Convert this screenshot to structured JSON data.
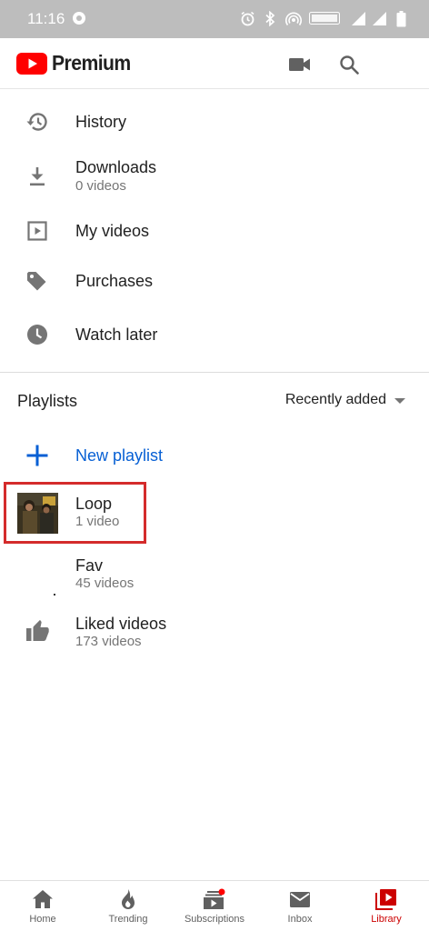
{
  "status_bar": {
    "time": "11:16"
  },
  "app": {
    "brand": "Premium",
    "brand_color": "#ff0000"
  },
  "menu": [
    {
      "label": "History",
      "sub": "",
      "icon": "history-icon"
    },
    {
      "label": "Downloads",
      "sub": "0 videos",
      "icon": "download-icon"
    },
    {
      "label": "My videos",
      "sub": "",
      "icon": "my-videos-icon"
    },
    {
      "label": "Purchases",
      "sub": "",
      "icon": "tag-icon"
    },
    {
      "label": "Watch later",
      "sub": "",
      "icon": "clock-icon"
    }
  ],
  "playlists": {
    "title": "Playlists",
    "sort": "Recently added",
    "new_label": "New playlist",
    "items": [
      {
        "title": "Loop",
        "sub": "1 video"
      },
      {
        "title": "Fav",
        "sub": "45 videos"
      },
      {
        "title": "Liked videos",
        "sub": "173 videos"
      }
    ]
  },
  "bottom_nav": [
    {
      "label": "Home",
      "icon": "home-icon"
    },
    {
      "label": "Trending",
      "icon": "flame-icon"
    },
    {
      "label": "Subscriptions",
      "icon": "subscriptions-icon"
    },
    {
      "label": "Inbox",
      "icon": "mail-icon"
    },
    {
      "label": "Library",
      "icon": "library-icon",
      "active": true
    }
  ],
  "colors": {
    "accent": "#cc0000",
    "link": "#065fd4",
    "highlight_box": "#d42b2b",
    "status_bar": "#bdbdbd"
  }
}
